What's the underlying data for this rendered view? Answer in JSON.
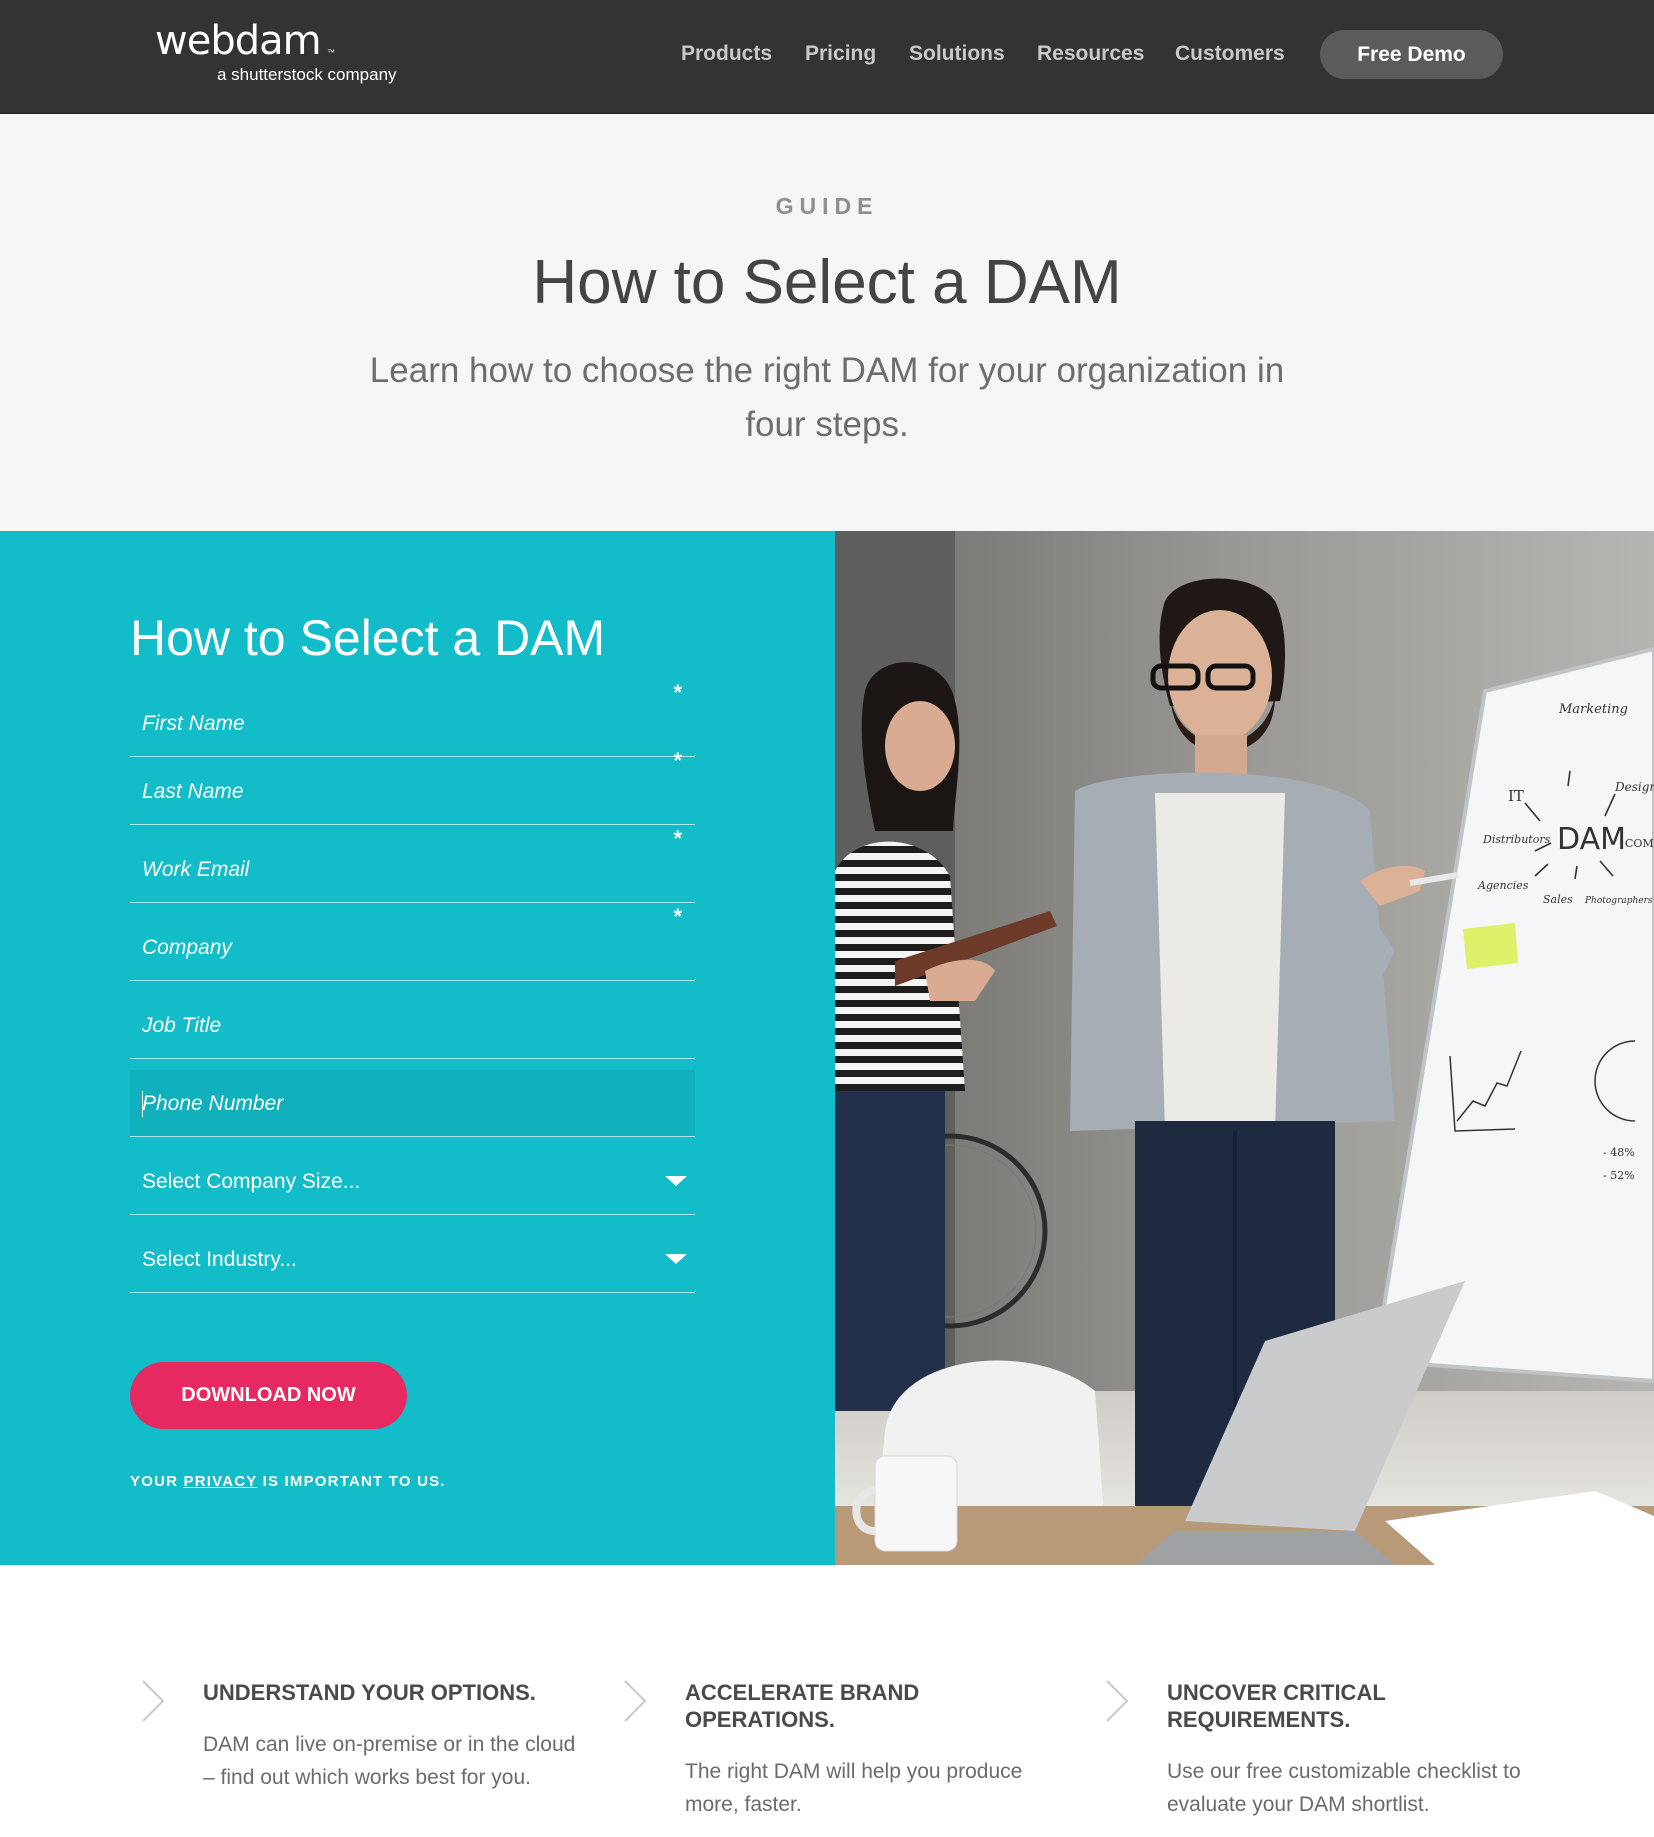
{
  "header": {
    "logo_word": "webdam",
    "logo_tm": "™",
    "logo_tagline": "a shutterstock company",
    "nav": [
      "Products",
      "Pricing",
      "Solutions",
      "Resources",
      "Customers"
    ],
    "cta": "Free Demo"
  },
  "hero": {
    "eyebrow": "GUIDE",
    "title": "How to Select a DAM",
    "subtitle": "Learn how to choose the right DAM for your organization in four steps."
  },
  "form": {
    "title": "How to Select a DAM",
    "fields": [
      {
        "label": "First Name",
        "required": "*"
      },
      {
        "label": "Last Name",
        "required": "*"
      },
      {
        "label": "Work Email",
        "required": "*"
      },
      {
        "label": "Company",
        "required": "*"
      },
      {
        "label": "Job Title",
        "required": ""
      },
      {
        "label": "Phone Number",
        "required": ""
      }
    ],
    "selects": [
      "Select Company Size...",
      "Select Industry..."
    ],
    "submit": "DOWNLOAD NOW",
    "privacy_pre": "YOUR ",
    "privacy_link": "PRIVACY",
    "privacy_post": " IS IMPORTANT TO US."
  },
  "whiteboard": {
    "center": "DAM",
    "words": [
      "Marketing",
      "IT",
      "Design",
      "Distributors",
      "Agencies",
      "Sales",
      "Photographers",
      "COM"
    ],
    "numbers": [
      "- 48%",
      "- 52%"
    ]
  },
  "features": [
    {
      "title": "UNDERSTAND YOUR OPTIONS.",
      "body": "DAM can live on-premise or in the cloud – find out which works best for you."
    },
    {
      "title": "ACCELERATE BRAND OPERATIONS.",
      "body": "The right DAM will help you produce more, faster."
    },
    {
      "title": "UNCOVER CRITICAL REQUIREMENTS.",
      "body": "Use our free customizable checklist to evaluate your DAM shortlist."
    }
  ],
  "colors": {
    "header_bg": "#333333",
    "form_bg": "#12bcc9",
    "download_button": "#e62a61",
    "demo_button": "#5b5b5b",
    "hero_bg": "#f6f6f6"
  }
}
